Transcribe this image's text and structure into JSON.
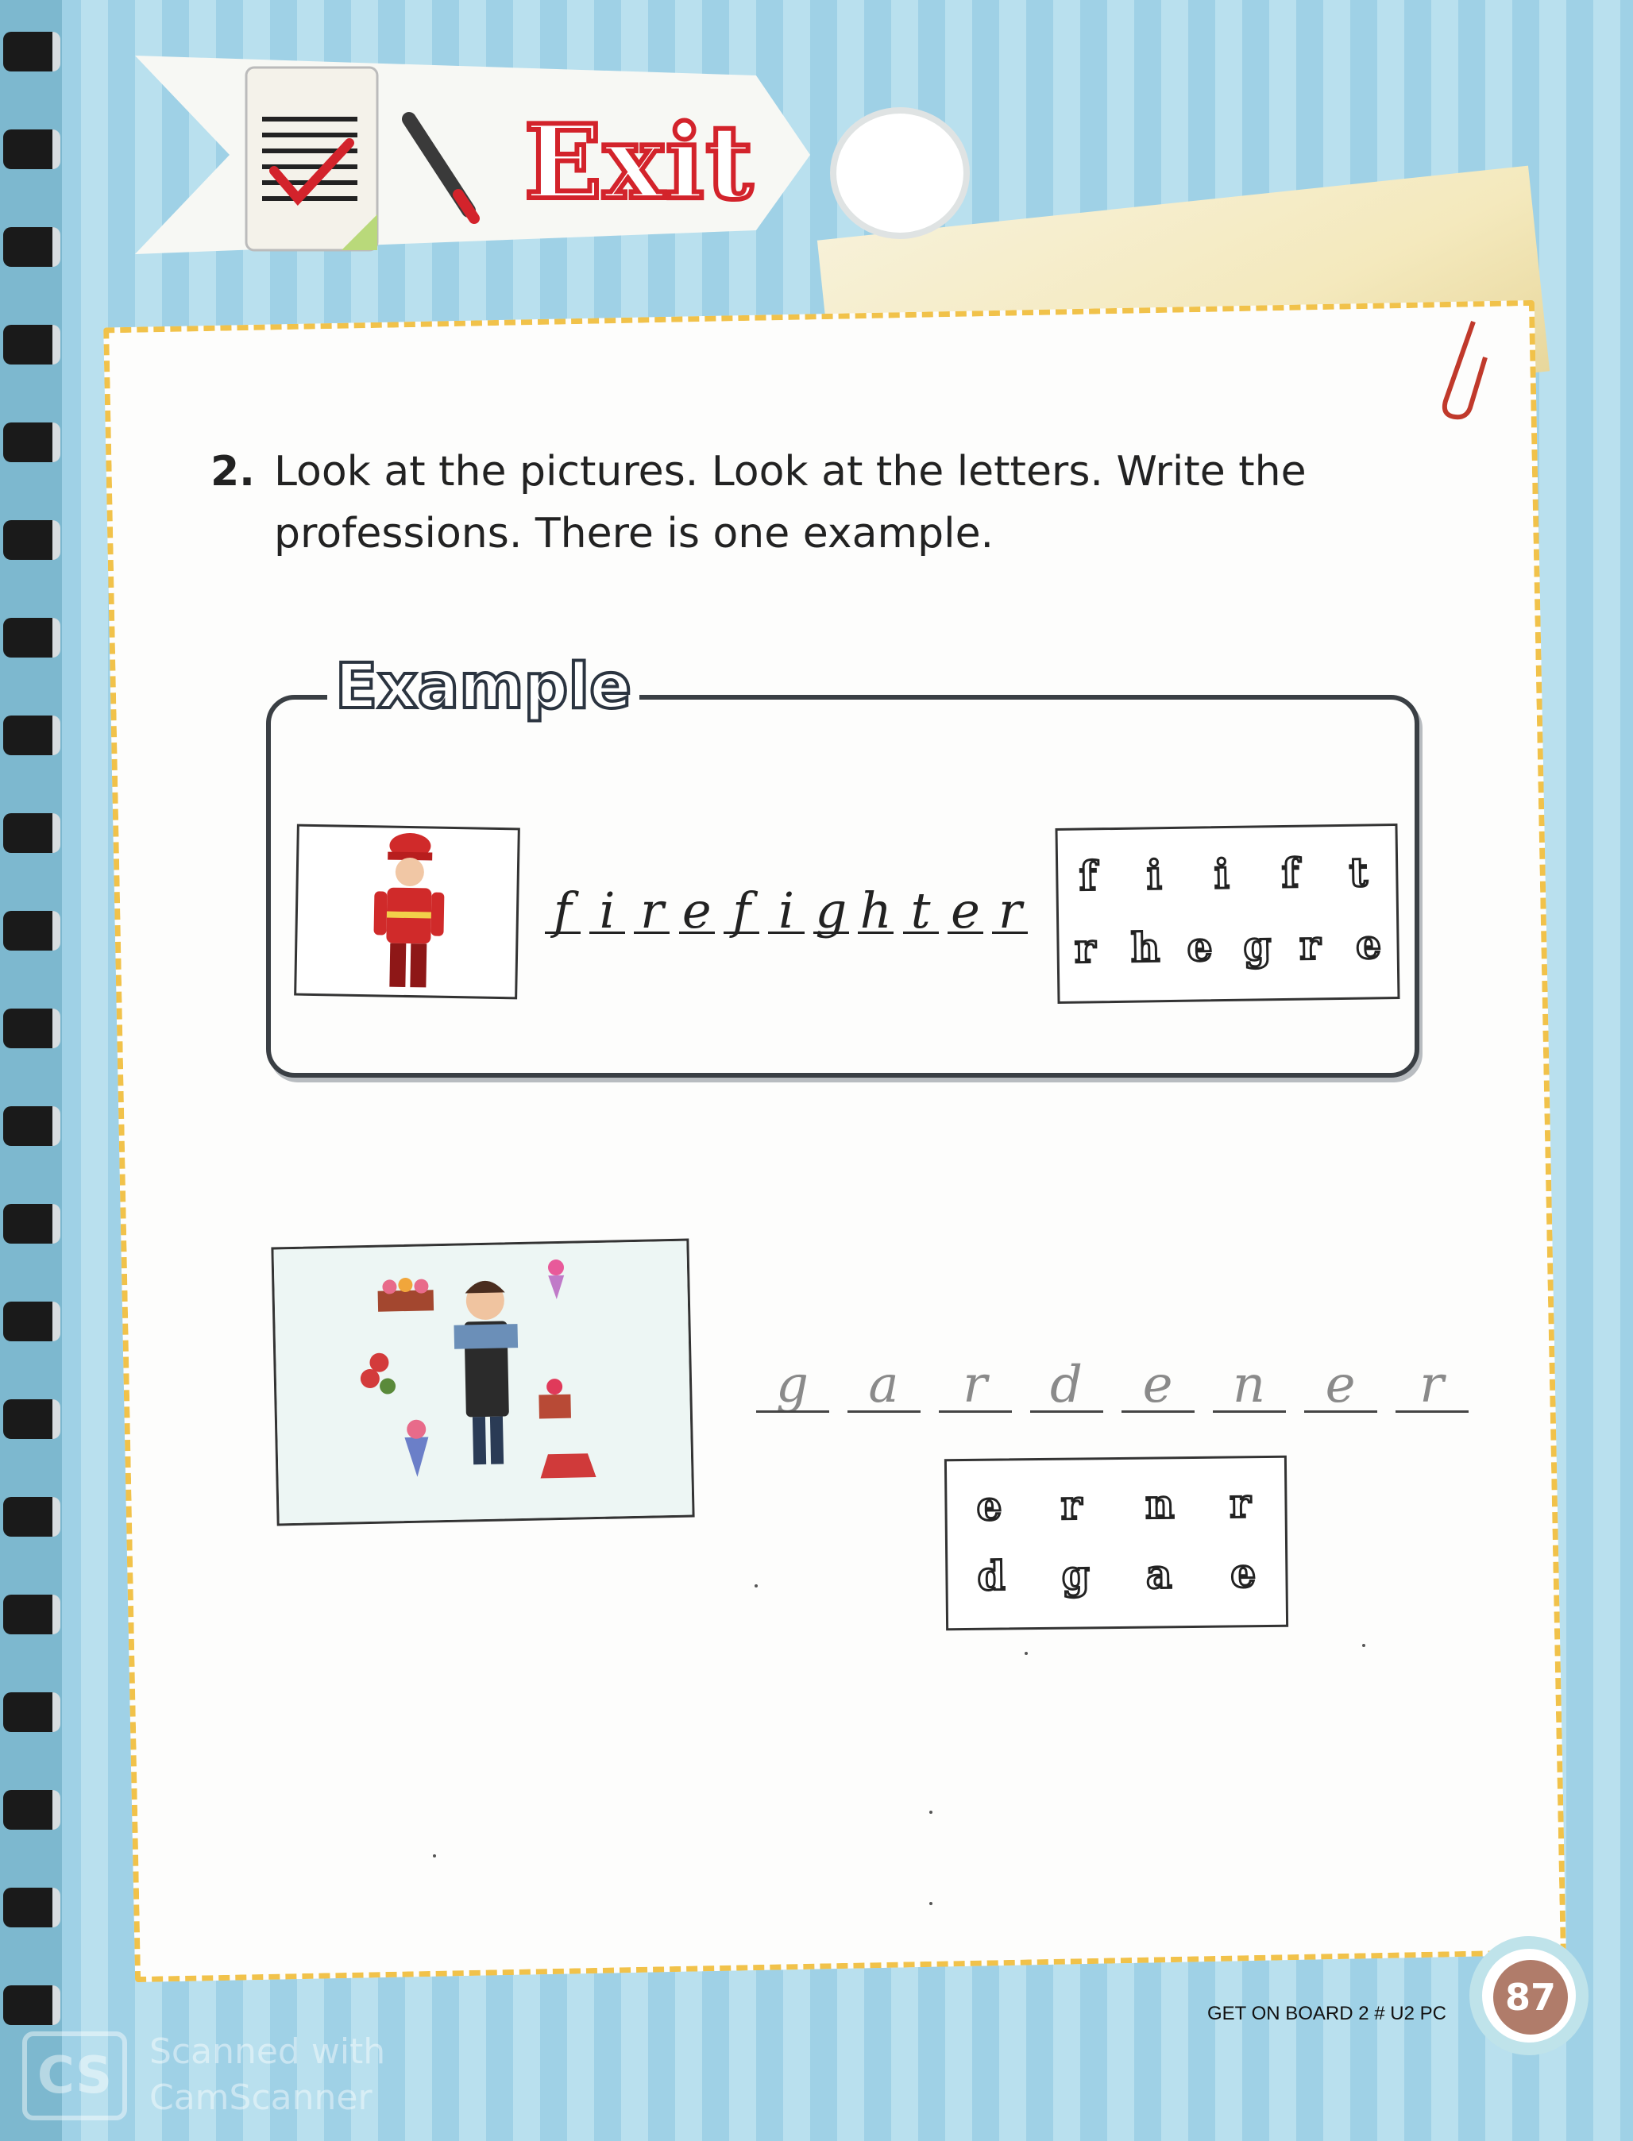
{
  "header": {
    "title": "Exit"
  },
  "exercise": {
    "number": "2.",
    "instruction": "Look at the pictures. Look at the letters. Write the professions. There is one example."
  },
  "example": {
    "badge": "Example",
    "answer_letters": [
      "f",
      "i",
      "r",
      "e",
      "f",
      "i",
      "g",
      "h",
      "t",
      "e",
      "r"
    ],
    "scrambled_row1": [
      "f",
      "i",
      "i",
      "f",
      "t"
    ],
    "scrambled_row2": [
      "r",
      "h",
      "e",
      "g",
      "r",
      "e"
    ]
  },
  "question": {
    "answer_letters": [
      "g",
      "a",
      "r",
      "d",
      "e",
      "n",
      "e",
      "r"
    ],
    "scrambled_row1": [
      "e",
      "r",
      "n",
      "r"
    ],
    "scrambled_row2": [
      "d",
      "g",
      "a",
      "e"
    ]
  },
  "footer": {
    "book": "GET ON BOARD 2 # U2 PC",
    "page": "87"
  },
  "watermark": {
    "logo": "CS",
    "line1": "Scanned with",
    "line2": "CamScanner"
  },
  "colors": {
    "paper_border": "#f1c24a",
    "title_red": "#d3232b",
    "stripe_blue": "#9fd1e6"
  }
}
